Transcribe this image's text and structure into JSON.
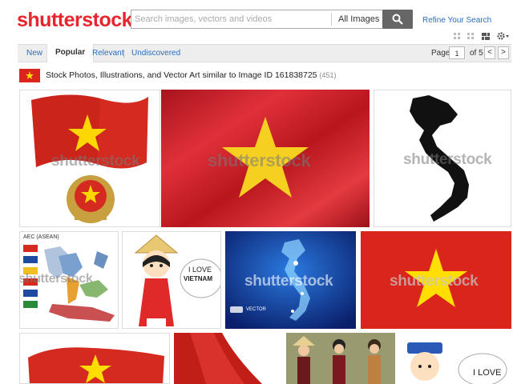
{
  "header": {
    "logo_text": "shutterstock",
    "search_placeholder": "Search images, vectors and videos",
    "search_scope": "All Images",
    "refine_label": "Refine Your Search"
  },
  "tabs": {
    "new": "New",
    "popular": "Popular",
    "relevant": "Relevant",
    "undiscovered": "Undiscovered"
  },
  "pagination": {
    "page_label": "Page",
    "current_page": "1",
    "of_label": "of 5",
    "prev": "<",
    "next": ">"
  },
  "headline": {
    "text": "Stock Photos, Illustrations, and Vector Art similar to Image ID 161838725",
    "count": "(451)"
  },
  "watermark": "shutterstock",
  "tiles": {
    "asean_title": "AEC (ASEAN)",
    "love_text_1": "I LOVE",
    "love_text_2": "VIETNAM",
    "vector_text": "VECTOR",
    "love_text_3": "I LOVE"
  },
  "colors": {
    "brand_red": "#e8252d",
    "flag_red": "#da251d",
    "star_yellow": "#ffde00",
    "link_blue": "#2a6ebb"
  }
}
